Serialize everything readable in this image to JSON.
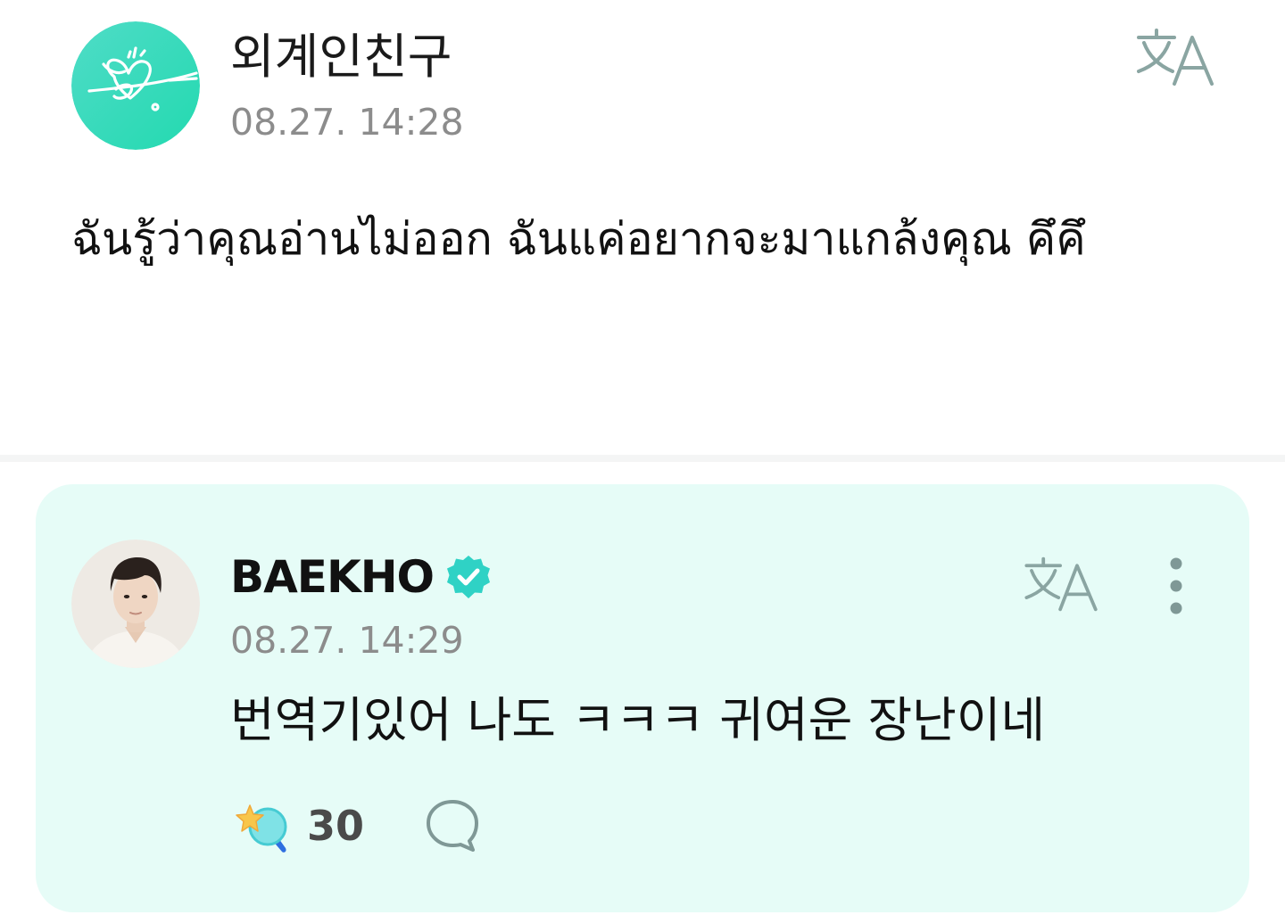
{
  "post": {
    "author": "외계인친구",
    "time": "08.27. 14:28",
    "body": "ฉันรู้ว่าคุณอ่านไม่ออก ฉันแค่อยากจะมาแกล้งคุณ คึคึ",
    "avatar_icon": "heart-sketch-logo-icon",
    "translate_icon": "translate-icon"
  },
  "comment": {
    "author": "BAEKHO",
    "verified_icon": "verified-badge-icon",
    "time": "08.27. 14:29",
    "body": "번역기있어 나도 ㅋㅋㅋ 귀여운 장난이네",
    "like_count": "30",
    "like_icon": "star-light-stick-icon",
    "reply_icon": "speech-bubble-icon",
    "more_icon": "more-vertical-icon"
  },
  "colors": {
    "accent": "#2fd2c5",
    "card_background": "#e6fcf7",
    "timestamp": "#8c8c8c",
    "translate_icon": "#8aa5a2"
  }
}
